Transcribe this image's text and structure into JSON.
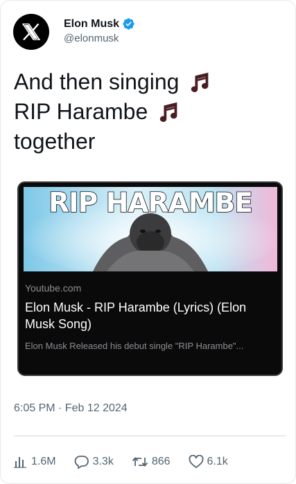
{
  "author": {
    "name": "Elon Musk",
    "handle": "@elonmusk",
    "avatar_icon": "x-logo-icon",
    "verified_icon": "verified-badge-icon",
    "verified_color": "#1d9bf0"
  },
  "tweet": {
    "lines": [
      "And then singing",
      "RIP Harambe",
      "together"
    ],
    "emoji_icon": "musical-notes-icon"
  },
  "link_card": {
    "thumbnail_text": "RIP HARAMBE",
    "domain": "Youtube.com",
    "title": "Elon Musk - RIP Harambe (Lyrics) (Elon Musk Song)",
    "description": "Elon Musk Released his debut single \"RIP Harambe\"..."
  },
  "timestamp": "6:05 PM · Feb 12 2024",
  "stats": {
    "views": "1.6M",
    "replies": "3.3k",
    "reposts": "866",
    "likes": "6.1k"
  }
}
